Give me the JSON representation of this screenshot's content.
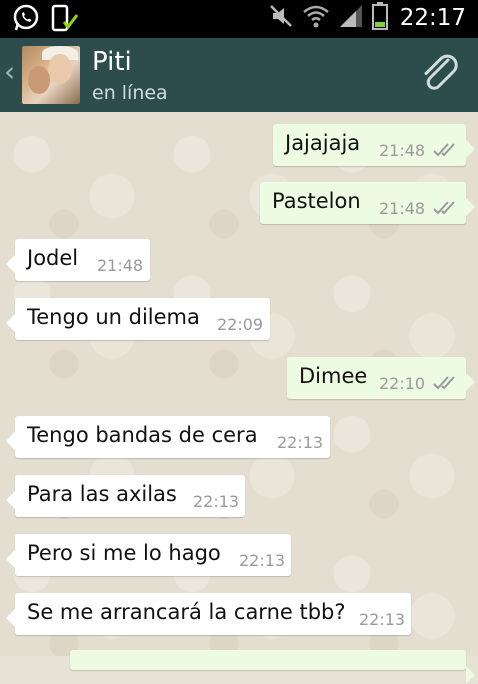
{
  "status_bar": {
    "time": "22:17"
  },
  "contact": {
    "name": "Piti",
    "status": "en línea"
  },
  "messages": [
    {
      "direction": "out",
      "text": "Jajajaja",
      "time": "21:48",
      "read": true
    },
    {
      "direction": "out",
      "text": "Pastelon",
      "time": "21:48",
      "read": true
    },
    {
      "direction": "in",
      "text": "Jodel",
      "time": "21:48"
    },
    {
      "direction": "in",
      "text": "Tengo un dilema",
      "time": "22:09"
    },
    {
      "direction": "out",
      "text": "Dimee",
      "time": "22:10",
      "read": true
    },
    {
      "direction": "in",
      "text": "Tengo bandas de cera",
      "time": "22:13"
    },
    {
      "direction": "in",
      "text": "Para las axilas",
      "time": "22:13"
    },
    {
      "direction": "in",
      "text": "Pero si me lo hago",
      "time": "22:13"
    },
    {
      "direction": "in",
      "text": "Se me arrancará la carne tbb?",
      "time": "22:13"
    }
  ],
  "colors": {
    "action_bar": "#2c4d4b",
    "outgoing_bubble": "#eefbe3",
    "incoming_bubble": "#ffffff",
    "chat_background": "#e4ded0"
  },
  "icons": {
    "status_left": [
      "whatsapp-icon",
      "phone-check-icon"
    ],
    "status_right": [
      "mute-icon",
      "wifi-icon",
      "signal-icon",
      "battery-icon"
    ],
    "action_bar": [
      "back-chevron-icon",
      "attach-paperclip-icon"
    ]
  }
}
